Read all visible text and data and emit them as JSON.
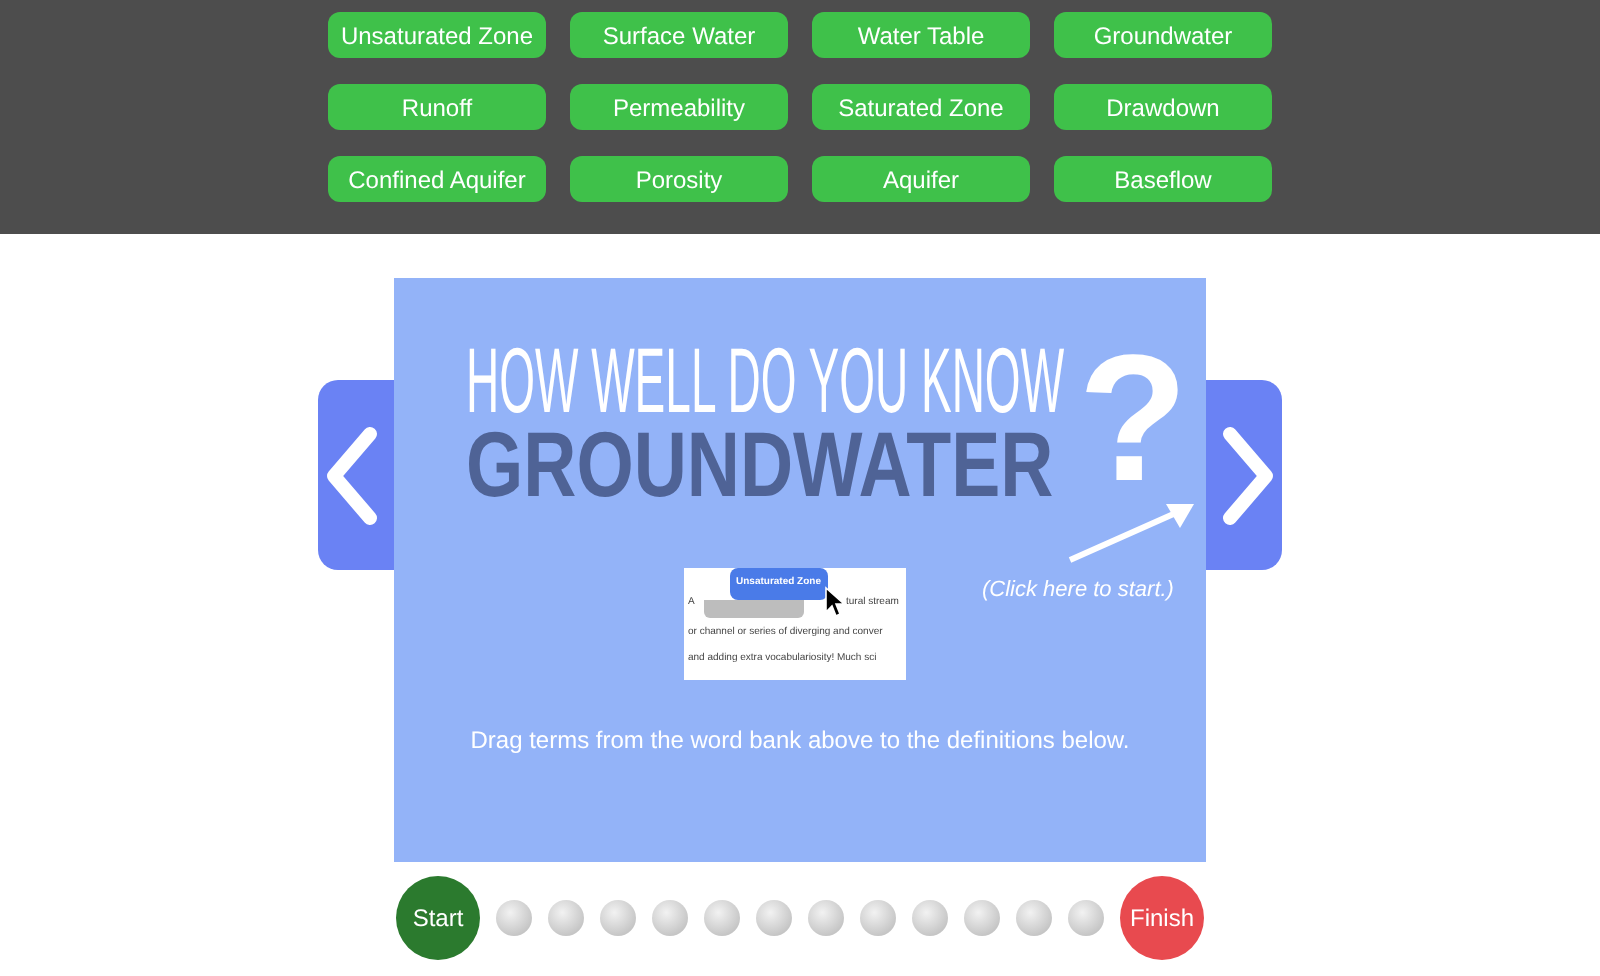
{
  "word_bank": [
    "Unsaturated Zone",
    "Surface Water",
    "Water Table",
    "Groundwater",
    "Runoff",
    "Permeability",
    "Saturated Zone",
    "Drawdown",
    "Confined Aquifer",
    "Porosity",
    "Aquifer",
    "Baseflow"
  ],
  "slide": {
    "title_line1": "HOW WELL DO YOU KNOW",
    "title_line2": "GROUNDWATER",
    "question_mark": "?",
    "hint": "(Click here to start.)",
    "example": {
      "chip": "Unsaturated Zone",
      "prefix": "A",
      "line1": "tural stream",
      "line2": "or channel or series of diverging and conver",
      "line3": "and adding extra vocabulariosity! Much sci"
    },
    "instruction": "Drag terms from the word bank above to the definitions below."
  },
  "progress": {
    "start": "Start",
    "finish": "Finish",
    "steps": [
      {
        "completed": false
      },
      {
        "completed": false
      },
      {
        "completed": false
      },
      {
        "completed": false
      },
      {
        "completed": false
      },
      {
        "completed": false
      },
      {
        "completed": false
      },
      {
        "completed": false
      },
      {
        "completed": false
      },
      {
        "completed": false
      },
      {
        "completed": false
      },
      {
        "completed": false
      }
    ]
  }
}
